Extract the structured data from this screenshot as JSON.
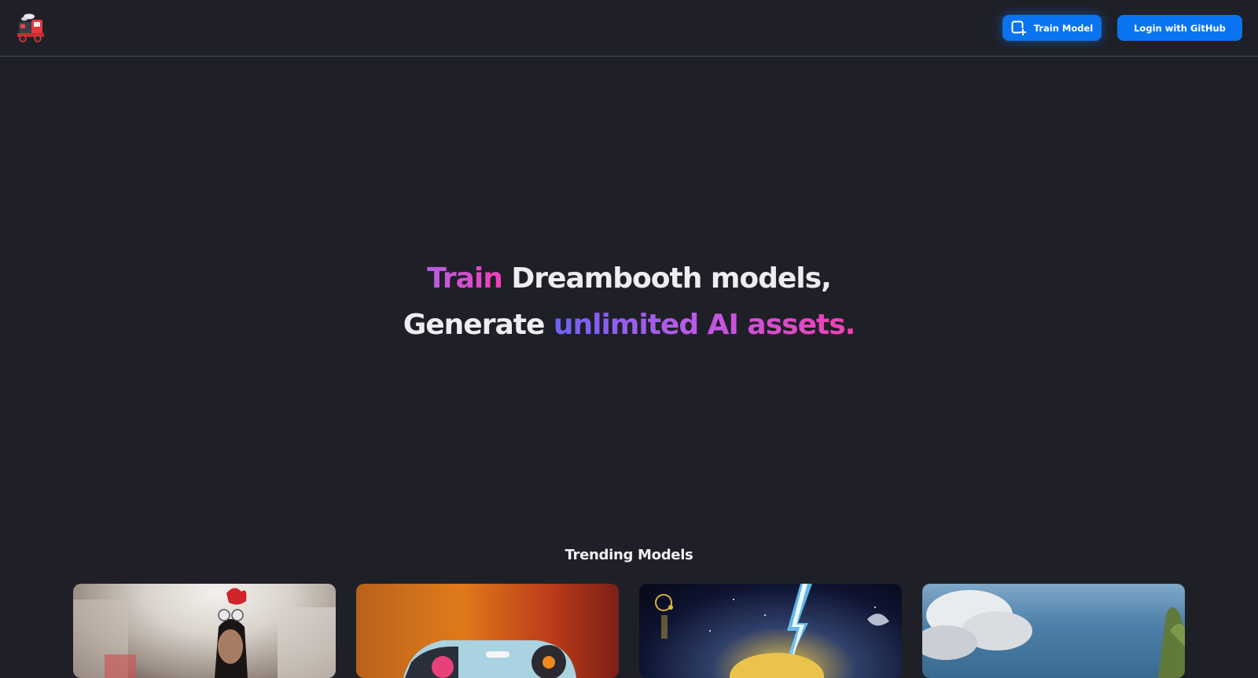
{
  "header": {
    "logo_icon": "train-logo-icon",
    "train_button": {
      "icon": "add-square-icon",
      "label": "Train Model"
    },
    "login_button": {
      "label": "Login with GitHub"
    }
  },
  "hero": {
    "line1_highlight": "Train",
    "line1_rest": " Dreambooth models,",
    "line2_start": "Generate ",
    "line2_highlight": "unlimited",
    "line2_highlight2": " AI assets."
  },
  "trending": {
    "title": "Trending Models",
    "cards": [
      {
        "image": "woman-portrait-image"
      },
      {
        "image": "orange-toy-car-image"
      },
      {
        "image": "space-lightning-image"
      },
      {
        "image": "sky-clouds-image"
      }
    ]
  },
  "colors": {
    "background": "#1f2027",
    "button": "#0a74f0",
    "accent_pink": "#f23fb4",
    "accent_purple": "#6d63f5"
  }
}
